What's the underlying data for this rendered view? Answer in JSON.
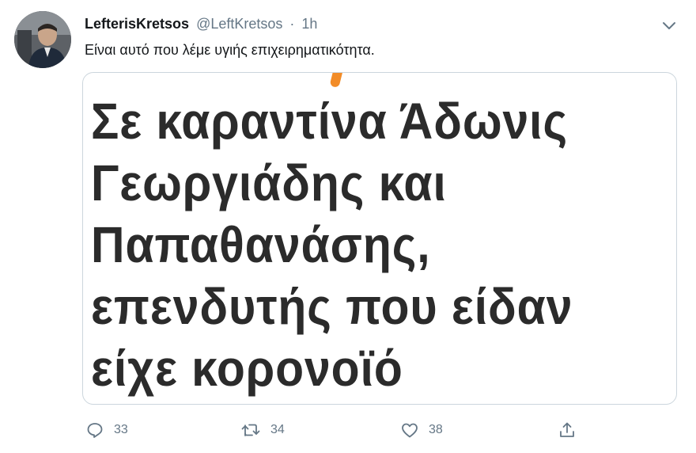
{
  "tweet": {
    "display_name": "LefterisKretsos",
    "handle": "@LeftKretsos",
    "separator": "·",
    "time": "1h",
    "text": "Είναι αυτό που λέμε υγιής επιχειρηματικότητα.",
    "media": {
      "headline_lines": [
        "Σε καραντίνα Άδωνις",
        "Γεωργιάδης και",
        "Παπαθανάσης,",
        "επενδυτής που είδαν",
        "είχε κορονοϊό"
      ],
      "accent_color": "#f28c28"
    },
    "actions": {
      "reply": {
        "icon": "reply-icon",
        "count": "33"
      },
      "retweet": {
        "icon": "retweet-icon",
        "count": "34"
      },
      "like": {
        "icon": "heart-icon",
        "count": "38"
      },
      "share": {
        "icon": "share-icon"
      }
    },
    "menu_icon": "chevron-down-icon"
  },
  "colors": {
    "text_primary": "#14171a",
    "text_secondary": "#657786",
    "border": "#ccd6dd",
    "headline": "#2b2b2b"
  }
}
